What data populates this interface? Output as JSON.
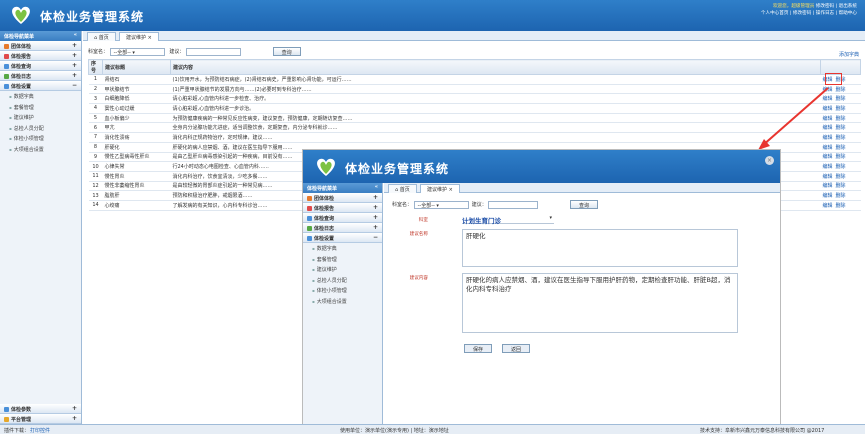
{
  "app_title": "体检业务管理系统",
  "header": {
    "user": "欢迎您，超级管理员",
    "links": "修改密码 | 退出系统",
    "line2": "个人中心首页 | 修改密码 | 操作日志 | 帮助中心"
  },
  "sidebar": {
    "title": "体检导航菜单",
    "groups": [
      "团体体检",
      "体检报告",
      "体检查询",
      "体检日志",
      "体检设置"
    ],
    "items": [
      "数据字典",
      "套餐管理",
      "建议维护",
      "总检人员分配",
      "体检小项管理",
      "大项组合设置"
    ],
    "bottom": [
      "体检参数",
      "平台管理"
    ]
  },
  "tabs": [
    "首页",
    "建议维护"
  ],
  "filter": {
    "dept_label": "科室名：",
    "dept_value": "--全部--",
    "keyword_label": "建议：",
    "search_btn": "查询",
    "add_type": "添加字典"
  },
  "table": {
    "headers": [
      "序号",
      "建议标题",
      "建议内容"
    ],
    "rows": [
      [
        "1",
        "肾结石",
        "(1)饮用开水，为预防结石病症，(2)肾结石病史，严重影响心肾功能，可运行……"
      ],
      [
        "2",
        "甲状腺结节",
        "(1)严重甲状腺结节的发展方向与……(2)必要时到专科治疗……"
      ],
      [
        "3",
        "白细胞降低",
        "请心脏彩超,心血管内科进一步检查、治疗。"
      ],
      [
        "4",
        "窦性心动过缓",
        "请心脏彩超,心血管内科进一步诊治。"
      ],
      [
        "5",
        "血小板偏少",
        "为预防健康疾病的一种常见反应性病变，建议复查，预防健康，定期随访复查……"
      ],
      [
        "6",
        "甲亢",
        "全身内分泌腺功能亢进症，适当调整饮食，定期复查，内分泌专科就诊……"
      ],
      [
        "7",
        "消化性溃疡",
        "消化内科正规药物治疗，定时规律，建议……"
      ],
      [
        "8",
        "肝硬化",
        "肝硬化的病人应禁烟、酒，建议在医生指导下服用……"
      ],
      [
        "9",
        "慢性乙型病毒性肝炎",
        "是由乙型肝炎病毒感染引起的一种疾病，目前没有……"
      ],
      [
        "10",
        "心律失常",
        "行24小时动态心电图检查、心血管内科……"
      ],
      [
        "11",
        "慢性胃炎",
        "消化内科治疗，饮食宜清淡，少吃多餐……"
      ],
      [
        "12",
        "慢性非萎缩性胃炎",
        "是由较轻微的胃部炎症引起的一种常见病……"
      ],
      [
        "13",
        "脂肪肝",
        "预防和积极治疗肥胖，戒烟限酒……"
      ],
      [
        "14",
        "心绞痛",
        "了解发病的有关知识，心内科专科诊治……"
      ]
    ],
    "edit": "编辑",
    "delete": "删除"
  },
  "footer": {
    "left": "插件下载：",
    "plugin": "打印控件",
    "center": "使用单位：演示单位(演示专用) | 地址：演示地址",
    "right": "技术支持：阜新市兴鑫元万泰信息科技有限公司 @2017"
  },
  "popup": {
    "filter_dept": "科室名：",
    "dept_value": "--全部--",
    "keyword": "建议：",
    "search": "查询",
    "dept_label": "科室",
    "dept_select": "计划生育门诊",
    "title_label": "建议名称",
    "title_value": "肝硬化",
    "content_label": "建议内容",
    "content_value": "肝硬化的病人应禁烟、酒，建议在医生指导下服用护肝药物，定期检查肝功能、肝脏B超，消化内科专科治疗",
    "save": "保存",
    "back": "返回"
  },
  "colors": {
    "header": "#1d64b0",
    "highlight": "#e8352f"
  }
}
